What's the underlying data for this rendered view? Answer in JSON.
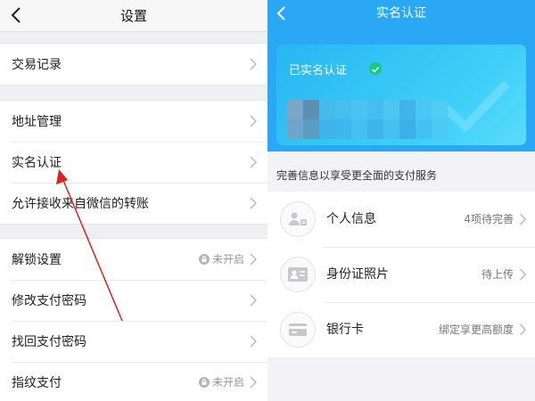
{
  "left": {
    "header": {
      "title": "设置"
    },
    "groups": [
      {
        "items": [
          {
            "label": "交易记录"
          }
        ]
      },
      {
        "items": [
          {
            "label": "地址管理"
          },
          {
            "label": "实名认证"
          },
          {
            "label": "允许接收来自微信的转账"
          }
        ]
      },
      {
        "items": [
          {
            "label": "解锁设置",
            "status": "未开启"
          },
          {
            "label": "修改支付密码"
          },
          {
            "label": "找回支付密码"
          },
          {
            "label": "指纹支付",
            "status": "未开启"
          }
        ]
      }
    ]
  },
  "right": {
    "header": {
      "title": "实名认证"
    },
    "card": {
      "label": "已实名认证"
    },
    "hint": "完善信息以享受更全面的支付服务",
    "items": [
      {
        "label": "个人信息",
        "status": "4项待完善",
        "icon": "person-card-icon"
      },
      {
        "label": "身份证照片",
        "status": "待上传",
        "icon": "id-card-icon"
      },
      {
        "label": "银行卡",
        "status": "绑定享更高额度",
        "icon": "bank-card-icon"
      }
    ]
  },
  "colors": {
    "accent": "#2aa8f5",
    "check": "#16c97e",
    "annotation_arrow": "#e02020"
  }
}
